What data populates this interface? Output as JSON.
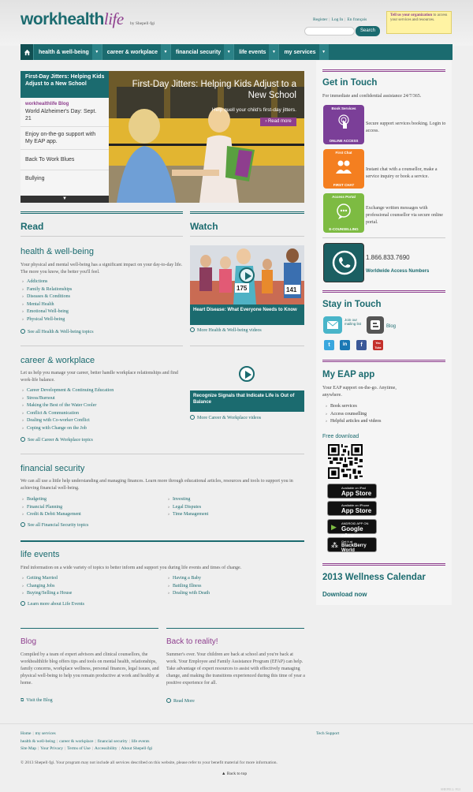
{
  "header": {
    "logo_work": "work",
    "logo_health": "health",
    "logo_life": "life",
    "logo_by": "by Shepell·fgi",
    "util_links": [
      "Register",
      "Log In",
      "En français"
    ],
    "search_placeholder": "",
    "search_button": "Search",
    "promo_bold": "Tell us your organization",
    "promo_text": " to access your services and resources."
  },
  "nav": {
    "home_icon": "house-icon",
    "items": [
      "health & well-being",
      "career & workplace",
      "financial security",
      "life events",
      "my services"
    ]
  },
  "hero": {
    "side_title": "First-Day Jitters: Helping Kids Adjust to a New School",
    "side_items": [
      {
        "kicker": "workhealthlife Blog",
        "text": "World Alzheimer's Day: Sept. 21"
      },
      {
        "kicker": "",
        "text": "Enjoy on-the-go support with My EAP app."
      },
      {
        "kicker": "",
        "text": "Back To Work Blues"
      },
      {
        "kicker": "",
        "text": "Bullying"
      }
    ],
    "title": "First-Day Jitters: Helping Kids Adjust to a New School",
    "subtitle": "Help quell your child's first-day jitters.",
    "read_more": "› Read more"
  },
  "read": {
    "heading": "Read",
    "health": {
      "title": "health & well-being",
      "desc": "Your physical and mental well-being has a significant impact on your day-to-day life. The more you know, the better you'll feel.",
      "links": [
        "Addictions",
        "Family & Relationships",
        "Diseases & Conditions",
        "Mental Health",
        "Emotional Well-being",
        "Physical Well-being"
      ],
      "more": "See all Health & Well-being topics"
    },
    "career": {
      "title": "career & workplace",
      "desc": "Let us help you manage your career, better handle workplace relationships and find work-life balance.",
      "links": [
        "Career Development & Continuing Education",
        "Stress/Burnout",
        "Making the Best of the Water Cooler",
        "Conflict & Communication",
        "Dealing with Co-worker Conflict",
        "Coping with Change on the Job"
      ],
      "more": "See all Career & Workplace topics"
    },
    "financial": {
      "title": "financial security",
      "desc": "We can all use a little help understanding and managing finances. Learn more through educational articles, resources and tools to support you in achieving financial well-being.",
      "links_left": [
        "Budgeting",
        "Financial Planning",
        "Credit & Debit Management"
      ],
      "links_right": [
        "Investing",
        "Legal Disputes",
        "Time Management"
      ],
      "more": "See all Financial Security topics"
    },
    "life": {
      "title": "life events",
      "desc": "Find information on a wide variety of topics to better inform and support you during life events and times of change.",
      "links_left": [
        "Getting Married",
        "Changing Jobs",
        "Buying/Selling a House"
      ],
      "links_right": [
        "Having a Baby",
        "Battling Illness",
        "Dealing with Death"
      ],
      "more": "Learn more about Life Events"
    }
  },
  "watch": {
    "heading": "Watch",
    "video1_caption": "Heart Disease: What Everyone Needs to Know",
    "video1_more": "More Health & Well-being videos",
    "video2_caption": "Recognize Signals that Indicate Life is Out of Balance",
    "video2_more": "More Career & Workplace videos",
    "bib_numbers": [
      "175",
      "141"
    ]
  },
  "sidebar": {
    "get_in_touch": "Get in Touch",
    "intro": "For immediate and confidential assistance 24/7/365.",
    "services": [
      {
        "tile_top": "Book Services",
        "tile_bottom": "ONLINE ACCESS",
        "color": "#7b3f98",
        "text": "Secure support services booking. Login to access."
      },
      {
        "tile_top": "First Chat",
        "tile_bottom": "FIRST CHAT",
        "color": "#f47f20",
        "text": "Instant chat with a counsellor, make a service inquiry or book a service."
      },
      {
        "tile_top": "Access Portal",
        "tile_bottom": "E-COUNSELLING",
        "color": "#7dbb42",
        "text": "Exchange written messages with professional counsellor via secure online portal."
      }
    ],
    "phone": "1.866.833.7690",
    "phone_label": "Worldwide Access Numbers",
    "stay_in_touch": "Stay in Touch",
    "mailing": "Join our mailing list",
    "blog": "Blog",
    "social": [
      "t",
      "in",
      "f",
      "You Tube"
    ],
    "eap_heading": "My EAP app",
    "eap_text": "Your EAP support on-the-go. Anytime, anywhere.",
    "eap_list": [
      "Book services",
      "Access counselling",
      "Helpful articles and videos"
    ],
    "free_download": "Free download",
    "stores": [
      {
        "small": "Available on iPad",
        "big": "App Store",
        "icon": ""
      },
      {
        "small": "Available on iPhone",
        "big": "App Store",
        "icon": ""
      },
      {
        "small": "ANDROID APP ON",
        "big": "Google play",
        "icon": "▶"
      },
      {
        "small": "Get it at",
        "big": "BlackBerry World",
        "icon": "⁂"
      }
    ],
    "calendar_heading": "2013 Wellness Calendar",
    "calendar_link": "Download now"
  },
  "blog": {
    "title": "Blog",
    "text": "Compiled by a team of expert advisors and clinical counsellors, the workhealthlife blog offers tips and tools on mental health, relationships, family concerns, workplace wellness, personal finances, legal issues, and physical well-being to help you remain productive at work and healthy at home.",
    "link": "Visit the Blog"
  },
  "back_to_reality": {
    "title": "Back to reality!",
    "text": "Summer's over. Your children are back at school and you're back at work. Your Employee and Family Assistance Program (EFAP) can help. Take advantage of expert resources to assist with effectively managing change, and making the transitions experienced during this time of year a positive experience for all.",
    "link": "Read More"
  },
  "footer": {
    "row1": [
      "Home",
      "my services"
    ],
    "row2": [
      "health & well-being",
      "career & workplace",
      "financial security",
      "life events"
    ],
    "row3": [
      "Site Map",
      "Your Privacy",
      "Terms of Use",
      "Accessibility",
      "About Shepell·fgi"
    ],
    "tech": "Tech Support",
    "copyright": "© 2013 Shepell·fgi. Your program may not include all services described on this website, please refer to your benefit material for more information.",
    "back_to_top": "Back to top",
    "shepell_tag": "SHEPELL·FGI"
  },
  "colors": {
    "teal": "#1b6b6f",
    "purple": "#8e3e8e",
    "promo_yellow": "#fff3a3"
  }
}
